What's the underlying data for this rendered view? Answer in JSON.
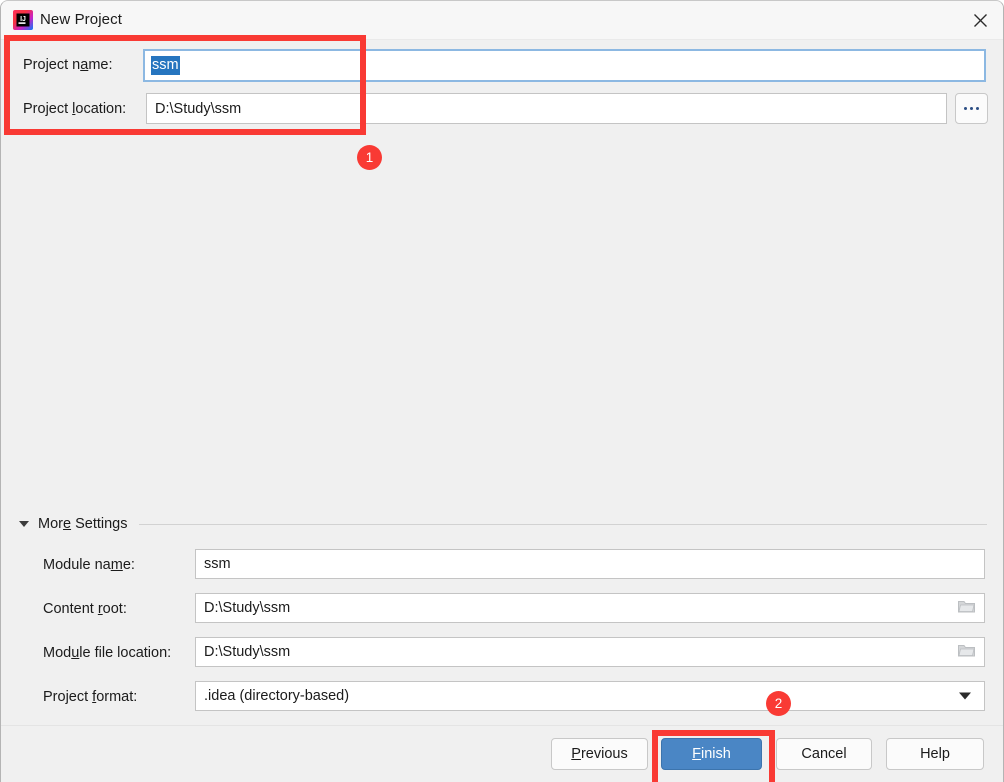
{
  "window": {
    "title": "New Project",
    "app_icon": "intellij-idea-icon",
    "close_icon": "close-icon",
    "background": "#f0f0f0"
  },
  "top_form": {
    "project_name": {
      "label_before": "Project n",
      "label_mnemonic": "a",
      "label_after": "me:",
      "value": "ssm",
      "selected": true,
      "focused": true
    },
    "project_location": {
      "label_before": "Project ",
      "label_mnemonic": "l",
      "label_after": "ocation:",
      "value": "D:\\Study\\ssm"
    },
    "browse_button": {
      "label": "...",
      "icon": "ellipsis-icon"
    }
  },
  "more_settings": {
    "title_before": "Mor",
    "title_mnemonic": "e",
    "title_after": " Settings",
    "expanded": true,
    "collapse_icon": "chevron-down-icon",
    "fields": [
      {
        "name": "module-name",
        "label_before": "Module na",
        "label_mnemonic": "m",
        "label_after": "e:",
        "value": "ssm",
        "trailing_icon": "none"
      },
      {
        "name": "content-root",
        "label_before": "Content ",
        "label_mnemonic": "r",
        "label_after": "oot:",
        "value": "D:\\Study\\ssm",
        "trailing_icon": "folder-icon"
      },
      {
        "name": "module-file-location",
        "label_before": "Mod",
        "label_mnemonic": "u",
        "label_after": "le file location:",
        "value": "D:\\Study\\ssm",
        "trailing_icon": "folder-icon"
      },
      {
        "name": "project-format",
        "label_before": "Project ",
        "label_mnemonic": "f",
        "label_after": "ormat:",
        "value": ".idea (directory-based)",
        "trailing_icon": "chevron-down-icon"
      }
    ]
  },
  "buttons": {
    "previous": {
      "before": "",
      "mnemonic": "P",
      "after": "revious"
    },
    "finish": {
      "before": "",
      "mnemonic": "F",
      "after": "inish",
      "primary": true,
      "accent": "#4a86c5"
    },
    "cancel": {
      "before": "Cancel",
      "mnemonic": "",
      "after": ""
    },
    "help": {
      "before": "Help",
      "mnemonic": "",
      "after": ""
    }
  },
  "annotations": {
    "color": "#f93a34",
    "badges": [
      {
        "id": "1",
        "label": "1"
      },
      {
        "id": "2",
        "label": "2"
      }
    ]
  }
}
